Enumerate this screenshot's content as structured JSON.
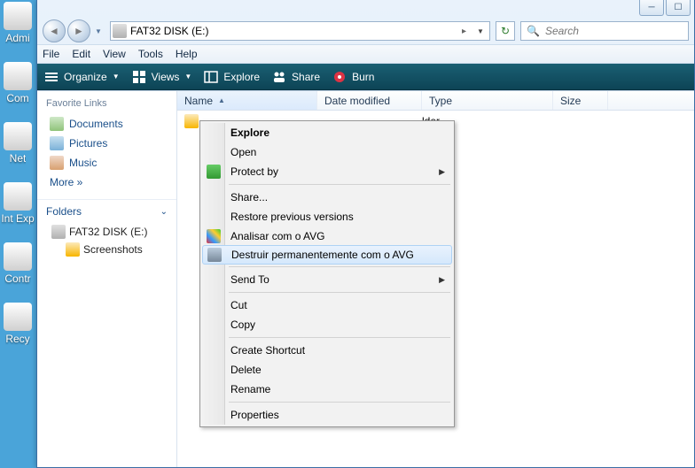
{
  "desktop": {
    "icons": [
      "Admi",
      "Com",
      "Net",
      "Int Exp",
      "Contr",
      "Recy"
    ]
  },
  "titlebar": {
    "min": "─",
    "max": "☐"
  },
  "address": {
    "path": "FAT32 DISK (E:)"
  },
  "search": {
    "placeholder": "Search"
  },
  "menubar": [
    "File",
    "Edit",
    "View",
    "Tools",
    "Help"
  ],
  "toolbar": {
    "organize": "Organize",
    "views": "Views",
    "explore": "Explore",
    "share": "Share",
    "burn": "Burn"
  },
  "favorites": {
    "header": "Favorite Links",
    "documents": "Documents",
    "pictures": "Pictures",
    "music": "Music",
    "more": "More »"
  },
  "folders": {
    "header": "Folders",
    "root": "FAT32 DISK (E:)",
    "child": "Screenshots"
  },
  "columns": {
    "name": "Name",
    "date": "Date modified",
    "type": "Type",
    "size": "Size"
  },
  "file": {
    "type_text": "lder"
  },
  "context": {
    "explore": "Explore",
    "open": "Open",
    "protect": "Protect by",
    "share": "Share...",
    "restore": "Restore previous versions",
    "avg_analyze": "Analisar com o AVG",
    "avg_destroy": "Destruir permanentemente com o AVG",
    "sendto": "Send To",
    "cut": "Cut",
    "copy": "Copy",
    "shortcut": "Create Shortcut",
    "delete": "Delete",
    "rename": "Rename",
    "properties": "Properties"
  }
}
